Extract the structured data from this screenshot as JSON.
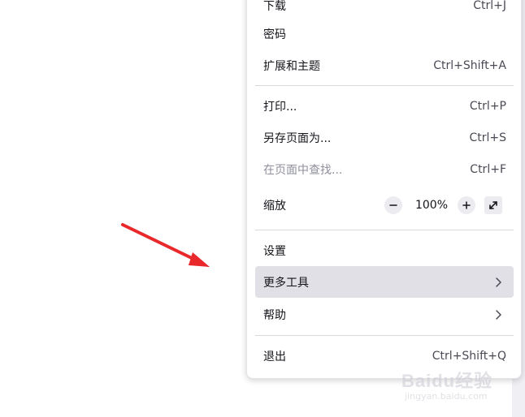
{
  "menu": {
    "items": [
      {
        "label": "下载",
        "shortcut": "Ctrl+J"
      },
      {
        "label": "密码",
        "shortcut": ""
      },
      {
        "label": "扩展和主题",
        "shortcut": "Ctrl+Shift+A"
      },
      {
        "label": "打印...",
        "shortcut": "Ctrl+P"
      },
      {
        "label": "另存页面为...",
        "shortcut": "Ctrl+S"
      },
      {
        "label": "在页面中查找...",
        "shortcut": "Ctrl+F",
        "disabled": true
      },
      {
        "label": "设置",
        "shortcut": ""
      },
      {
        "label": "更多工具",
        "submenu": true,
        "highlighted": true
      },
      {
        "label": "帮助",
        "submenu": true
      },
      {
        "label": "退出",
        "shortcut": "Ctrl+Shift+Q"
      }
    ],
    "zoom": {
      "label": "缩放",
      "value": "100%",
      "minus_icon": "minus-icon",
      "plus_icon": "plus-icon",
      "fullscreen_icon": "fullscreen-icon"
    },
    "highlight_color": "#e0e0e6"
  },
  "annotation": {
    "arrow_color": "#e8282b"
  },
  "watermark": {
    "brand": "Baidu经验",
    "url": "jingyan.baidu.com"
  }
}
